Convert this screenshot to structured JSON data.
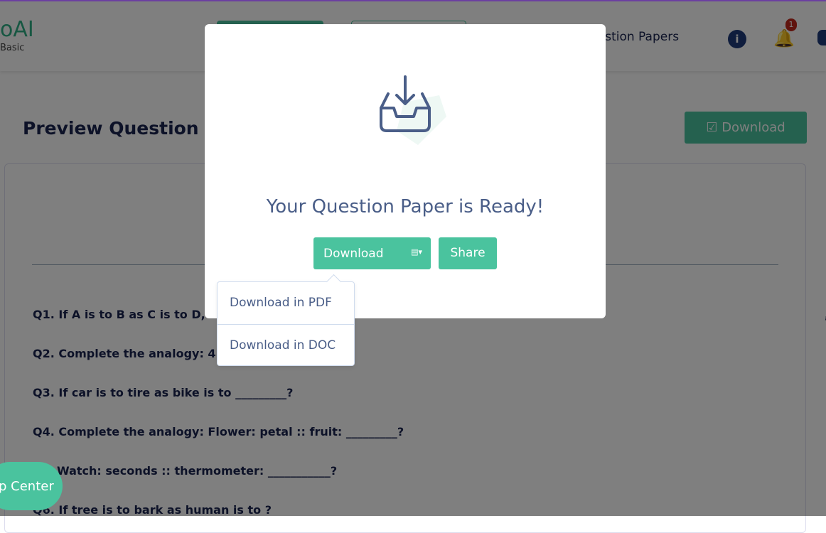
{
  "header": {
    "logo": "oAI",
    "plan": "Basic",
    "nav_question_papers": "uestion Papers",
    "notification_count": "1"
  },
  "page": {
    "title": "Preview Question P",
    "download_label": "Download"
  },
  "questions": [
    {
      "text": "Q1. If A is to B as C is to D, fir",
      "tail": ", , ,"
    },
    {
      "text": "Q2. Complete the analogy: 4"
    },
    {
      "text": "Q3. If car is to tire as bike is to _________?"
    },
    {
      "text": "Q4. Complete the analogy: Flower: petal :: fruit: _________?"
    },
    {
      "text": "Watch: seconds :: thermometer: ___________?"
    },
    {
      "text": "Q6. If tree is to bark as human is to                       ?"
    }
  ],
  "help_center": "p Center",
  "modal": {
    "title": "Your Question Paper is Ready!",
    "download": "Download",
    "share": "Share"
  },
  "menu": [
    "Download in PDF",
    "Download in DOC"
  ],
  "colors": {
    "accent": "#4ac39e",
    "navy": "#1a2450",
    "text": "#4a5e88"
  }
}
